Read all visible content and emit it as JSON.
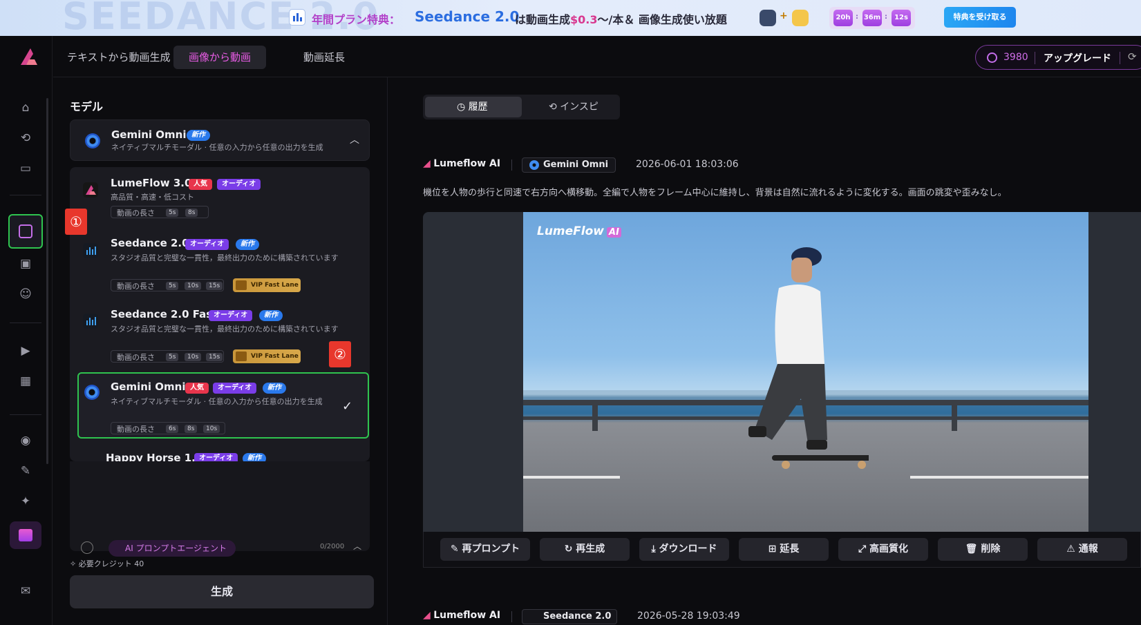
{
  "banner": {
    "watermark": "SEEDANCE 2.0",
    "offer_label": "年間プラン特典：",
    "product": "Seedance 2.0",
    "text_before": "は動画生成",
    "price": "$0.3",
    "text_after": "〜/本＆ 画像生成使い放題",
    "plus": "+",
    "timer": {
      "h": "20h",
      "m": "36m",
      "s": "12s",
      "sep": ":"
    },
    "claim_button": "特典を受け取る"
  },
  "topbar": {
    "tabs": [
      {
        "label": "テキストから動画生成"
      },
      {
        "label": "画像から動画"
      },
      {
        "label": "動画延長"
      }
    ],
    "credits": "3980",
    "upgrade": "アップグレード"
  },
  "panel": {
    "title": "モデル",
    "current": {
      "name": "Gemini Omni",
      "badge_new": "新作",
      "desc": "ネイティブマルチモーダル · 任意の入力から任意の出力を生成"
    },
    "duration_label": "動画の長さ",
    "badges": {
      "popular": "人気",
      "audio": "オーディオ",
      "new": "新作"
    },
    "vip": "VIP Fast Lane",
    "models": [
      {
        "name": "LumeFlow 3.0",
        "desc": "高品質・高速・低コスト",
        "durations": [
          "5s",
          "8s"
        ]
      },
      {
        "name": "Seedance 2.0",
        "desc": "スタジオ品質と完璧な一貫性，最終出力のために構築されています",
        "durations": [
          "5s",
          "10s",
          "15s"
        ]
      },
      {
        "name": "Seedance 2.0 Fast",
        "desc": "スタジオ品質と完璧な一貫性，最終出力のために構築されています",
        "durations": [
          "5s",
          "10s",
          "15s"
        ]
      },
      {
        "name": "Gemini Omni",
        "desc": "ネイティブマルチモーダル · 任意の入力から任意の出力を生成",
        "durations": [
          "6s",
          "8s",
          "10s"
        ]
      },
      {
        "name": "Happy Horse 1.0"
      }
    ],
    "markers": [
      "①",
      "②"
    ],
    "agent": "AI プロンプトエージェント",
    "char_count": "0/2000",
    "credit_need": "必要クレジット 40",
    "generate": "生成"
  },
  "history": {
    "seg": [
      "履歴",
      "インスピ"
    ],
    "entries": [
      {
        "brand": "Lumeflow AI",
        "model": "Gemini Omni",
        "time": "2026-06-01 18:03:06",
        "prompt": "機位を人物の歩行と同速で右方向へ横移動。全編で人物をフレーム中心に維持し、背景は自然に流れるように変化する。画面の跳変や歪みなし。"
      },
      {
        "brand": "Lumeflow AI",
        "model": "Seedance 2.0",
        "time": "2026-05-28 19:03:49"
      }
    ],
    "video_watermark": "LumeFlow",
    "video_watermark_badge": "AI",
    "actions": [
      "再プロンプト",
      "再生成",
      "ダウンロード",
      "延長",
      "高画質化",
      "削除",
      "通報"
    ]
  }
}
